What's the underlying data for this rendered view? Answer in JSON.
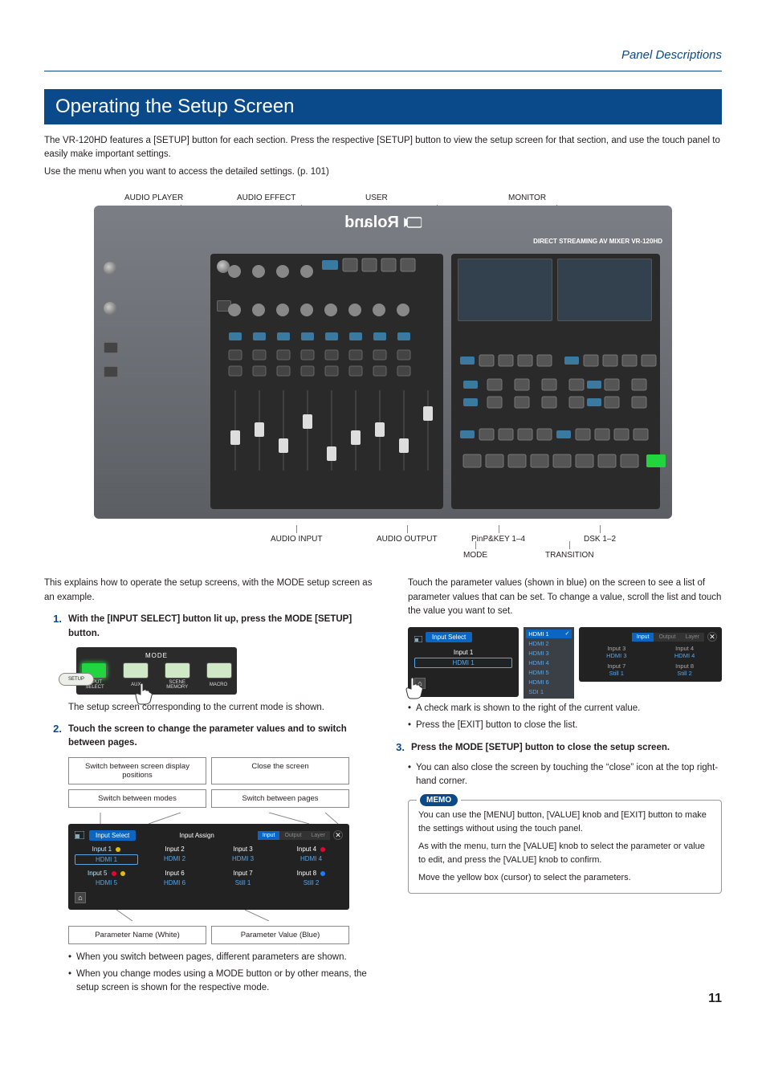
{
  "header": {
    "section": "Panel Descriptions"
  },
  "title": "Operating the Setup Screen",
  "intro": [
    "The VR-120HD features a [SETUP] button for each section. Press the respective [SETUP] button to view the setup screen for that section, and use the touch panel to easily make important settings.",
    "Use the menu when you want to access the detailed settings. (p. 101)"
  ],
  "diagram": {
    "top_labels": [
      "AUDIO PLAYER",
      "AUDIO EFFECT",
      "USER",
      "MONITOR"
    ],
    "brand": "Roland",
    "model_line": "DIRECT STREAMING AV MIXER  VR-120HD",
    "bottom_labels_row1": [
      "AUDIO INPUT",
      "AUDIO OUTPUT",
      "PinP&KEY 1–4",
      "DSK 1–2"
    ],
    "bottom_labels_row2": [
      "MODE",
      "TRANSITION"
    ]
  },
  "left_col": {
    "lead": "This explains how to operate the setup screens, with the MODE setup screen as an example.",
    "step1": {
      "num": "1.",
      "text": "With the [INPUT SELECT] button lit up, press the MODE [SETUP] button."
    },
    "fig_mode": {
      "title": "MODE",
      "labels": [
        "INPUT\nSELECT",
        "AUX",
        "SCENE\nMEMORY",
        "MACRO"
      ],
      "setup": "SETUP"
    },
    "cap1": "The setup screen corresponding to the current mode is shown.",
    "step2": {
      "num": "2.",
      "text": "Touch the screen to change the parameter values and to switch between pages."
    },
    "fig_ts": {
      "lbl_top_left": "Switch between screen display positions",
      "lbl_top_right": "Close the screen",
      "lbl_mid_left": "Switch between modes",
      "lbl_mid_right": "Switch between pages",
      "tab": "Input Select",
      "title": "Input Assign",
      "pages": [
        "Input",
        "Output",
        "Layer"
      ],
      "params": [
        {
          "n": "Input 1",
          "v": "HDMI 1",
          "hi": true
        },
        {
          "n": "Input 2",
          "v": "HDMI 2"
        },
        {
          "n": "Input 3",
          "v": "HDMI 3"
        },
        {
          "n": "Input 4",
          "v": "HDMI 4",
          "dot": "red"
        },
        {
          "n": "Input 5",
          "v": "HDMI 5",
          "dot": "red",
          "hi": true
        },
        {
          "n": "Input 6",
          "v": "HDMI 6"
        },
        {
          "n": "Input 7",
          "v": "Still 1"
        },
        {
          "n": "Input 8",
          "v": "Still 2",
          "dot": "blue"
        }
      ],
      "legend_left": "Parameter Name (White)",
      "legend_right": "Parameter Value (Blue)"
    },
    "bullets": [
      "When you switch between pages, different parameters are shown.",
      "When you change modes using a MODE button or by other means, the setup screen is shown for the respective mode."
    ]
  },
  "right_col": {
    "lead": "Touch the parameter values (shown in blue) on the screen to see a list of parameter values that can be set. To change a value, scroll the list and touch the value you want to set.",
    "fig_pl": {
      "tab": "Input Select",
      "sub": "Input 1",
      "val": "HDMI 1",
      "list": [
        "HDMI 1",
        "HDMI 2",
        "HDMI 3",
        "HDMI 4",
        "HDMI 5",
        "HDMI 6",
        "SDI 1"
      ],
      "pages": [
        "Input",
        "Output",
        "Layer"
      ],
      "grid": [
        {
          "p": "Input 3",
          "v": "HDMI 3"
        },
        {
          "p": "Input 4",
          "v": "HDMI 4"
        },
        {
          "p": "Input 7",
          "v": "Still 1"
        },
        {
          "p": "Input 8",
          "v": "Still 2"
        }
      ]
    },
    "bullets1": [
      "A check mark is shown to the right of the current value.",
      "Press the [EXIT] button to close the list."
    ],
    "step3": {
      "num": "3.",
      "text": "Press the MODE [SETUP] button to close the setup screen."
    },
    "bullets2": [
      "You can also close the screen by touching the “close” icon at the top right-hand corner."
    ],
    "memo": {
      "tag": "MEMO",
      "lines": [
        "You can use the [MENU] button, [VALUE] knob and [EXIT] button to make the settings without using the touch panel.",
        "As with the menu, turn the [VALUE] knob to select the parameter or value to edit, and press the [VALUE] knob to confirm.",
        "Move the yellow box (cursor) to select the parameters."
      ]
    }
  },
  "page_number": "11"
}
